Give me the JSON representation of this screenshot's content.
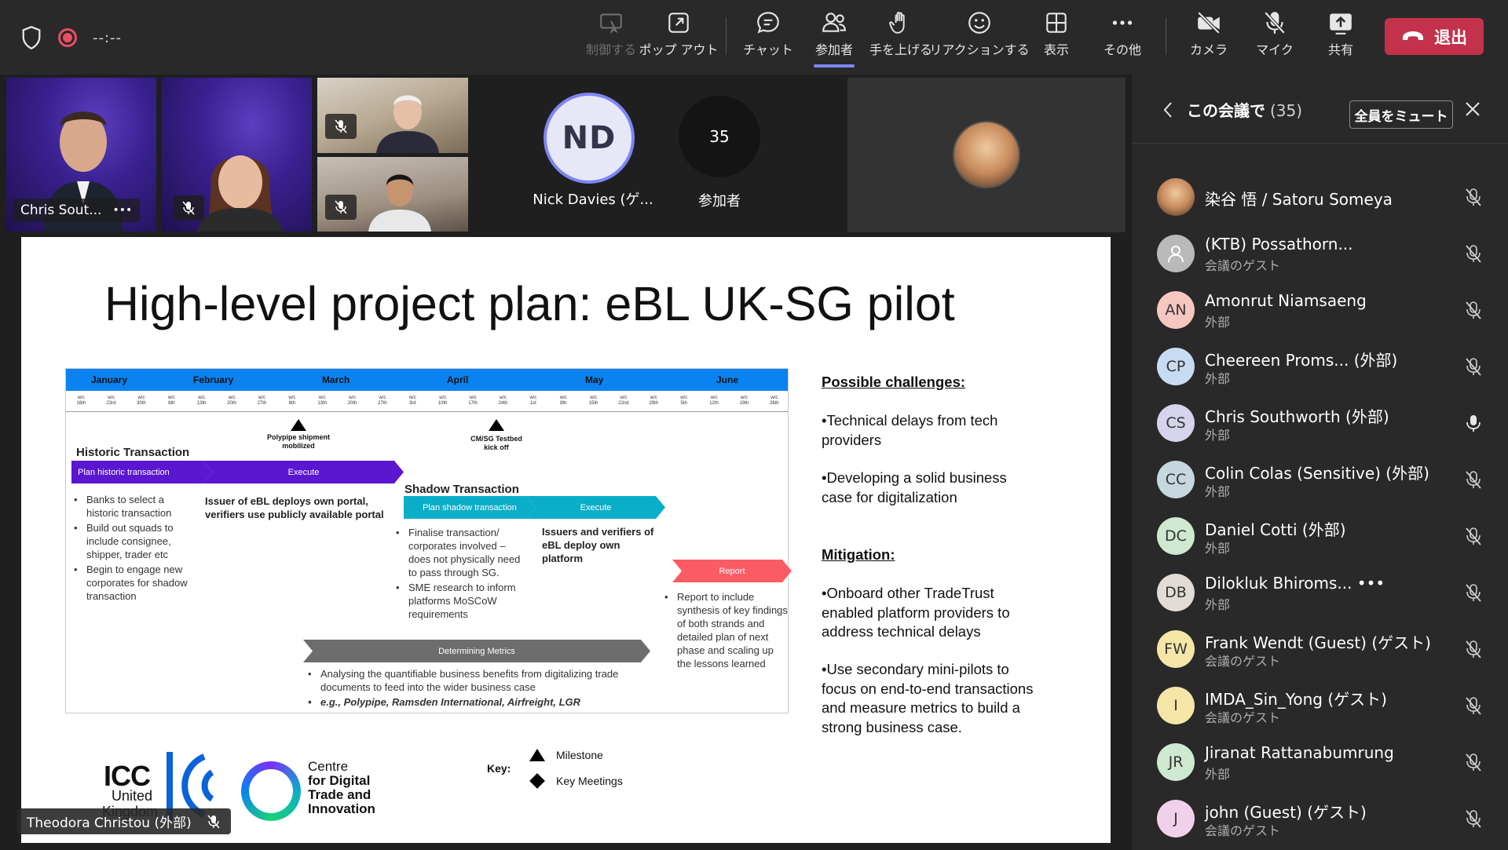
{
  "topbar": {
    "timer": "--:--",
    "buttons": {
      "control": "制御する",
      "popout": "ポップ アウト",
      "chat": "チャット",
      "participants": "参加者",
      "raise_hand": "手を上げる",
      "react": "リアクションする",
      "view": "表示",
      "more": "その他",
      "camera": "カメラ",
      "mic": "マイク",
      "share": "共有",
      "leave": "退出"
    }
  },
  "videos": {
    "tile1_name": "Chris Sout...",
    "tile1_more": "•••",
    "nick_initials": "ND",
    "nick_name": "Nick Davies (ゲ...",
    "count": "35",
    "count_label": "参加者"
  },
  "slide": {
    "title": "High-level project plan: eBL UK-SG pilot",
    "months": [
      "January",
      "February",
      "March",
      "April",
      "May",
      "June"
    ],
    "weeks": [
      "w/c 16th",
      "w/c 23rd",
      "w/c 30th",
      "w/c 6th",
      "w/c 13th",
      "w/c 20th",
      "w/c 27th",
      "w/c 6th",
      "w/c 13th",
      "w/c 20th",
      "w/c 27th",
      "w/c 3rd",
      "w/c 10th",
      "w/c 17th",
      "w/c 24th",
      "w/c 1st",
      "w/c 8th",
      "w/c 15th",
      "w/c 22nd",
      "w/c 29th",
      "w/c 5th",
      "w/c 12th",
      "w/c 19th",
      "w/c 26th"
    ],
    "milestone1": "Polypipe shipment mobilized",
    "milestone2": "CM/SG Testbed kick off",
    "historic_header": "Historic Transaction",
    "plan_historic": "Plan historic transaction",
    "execute1": "Execute",
    "historic_bullets": [
      "Banks to select a historic transaction",
      "Build out squads to include consignee, shipper, trader etc",
      "Begin to engage new corporates for shadow transaction"
    ],
    "execute1_text": "Issuer of eBL deploys own portal, verifiers use publicly available portal",
    "shadow_header": "Shadow Transaction",
    "plan_shadow": "Plan shadow transaction",
    "execute2": "Execute",
    "shadow_bullets": [
      "Finalise transaction/ corporates involved – does not physically need to pass through SG.",
      "SME research to inform platforms MoSCoW requirements"
    ],
    "execute2_text": "Issuers and verifiers of eBL deploy own platform",
    "report": "Report",
    "report_bullets": [
      "Report to include synthesis of key findings of both strands  and detailed plan of next phase and scaling up the lessons learned"
    ],
    "metrics": "Determining Metrics",
    "metrics_bullet1": "Analysing the quantifiable business benefits from digitalizing trade documents to feed into the wider business case",
    "metrics_bullet2": "e.g., Polypipe, Ramsden International, Airfreight, LGR",
    "challenges_h": "Possible challenges:",
    "challenge1": "•Technical delays from tech providers",
    "challenge2": "•Developing a solid business case for digitalization",
    "mitigation_h": "Mitigation:",
    "mitigation1": "•Onboard other TradeTrust enabled platform providers to address technical delays",
    "mitigation2": "•Use secondary mini-pilots to focus on end-to-end transactions and measure metrics to build a strong business case.",
    "key_label": "Key:",
    "key_milestone": "Milestone",
    "key_meetings": "Key Meetings",
    "icc_line1": "ICC",
    "icc_line2": "United",
    "icc_line3": "Kingdom",
    "cdti_line1": "Centre",
    "cdti_line2": "for Digital",
    "cdti_line3": "Trade and",
    "cdti_line4": "Innovation"
  },
  "presenter": "Theodora Christou (外部)",
  "panel": {
    "title": "この会議で",
    "count": "(35)",
    "mute_all": "全員をミュート",
    "participants": [
      {
        "name": "染谷 悟 / Satoru Someya",
        "sub": "",
        "initials": "",
        "avatar_color": "#c7a07a",
        "mic": "muted"
      },
      {
        "name": "(KTB) Possathorn...",
        "sub": "会議のゲスト",
        "initials": "",
        "avatar_color": "#b9b9b9",
        "mic": "muted"
      },
      {
        "name": "Amonrut Niamsaeng",
        "sub": "外部",
        "initials": "AN",
        "avatar_color": "#f6c7c0",
        "mic": "muted"
      },
      {
        "name": "Cheereen Proms... (外部)",
        "sub": "外部",
        "initials": "CP",
        "avatar_color": "#c7dcf2",
        "mic": "muted"
      },
      {
        "name": "Chris Southworth (外部)",
        "sub": "外部",
        "initials": "CS",
        "avatar_color": "#d5d4ec",
        "mic": "on"
      },
      {
        "name": "Colin Colas (Sensitive) (外部)",
        "sub": "外部",
        "initials": "CC",
        "avatar_color": "#c7d7df",
        "mic": "muted"
      },
      {
        "name": "Daniel Cotti (外部)",
        "sub": "外部",
        "initials": "DC",
        "avatar_color": "#cfe8d0",
        "mic": "muted"
      },
      {
        "name": "Dilokluk Bhiroms... •••",
        "sub": "外部",
        "initials": "DB",
        "avatar_color": "#e2dcd6",
        "mic": "muted"
      },
      {
        "name": "Frank Wendt (Guest) (ゲスト)",
        "sub": "会議のゲスト",
        "initials": "FW",
        "avatar_color": "#f5e6a8",
        "mic": "muted"
      },
      {
        "name": "IMDA_Sin_Yong (ゲスト)",
        "sub": "会議のゲスト",
        "initials": "I",
        "avatar_color": "#f5e6a8",
        "mic": "muted"
      },
      {
        "name": "Jiranat Rattanabumrung",
        "sub": "外部",
        "initials": "JR",
        "avatar_color": "#cfe8d0",
        "mic": "muted"
      },
      {
        "name": "john (Guest) (ゲスト)",
        "sub": "会議のゲスト",
        "initials": "J",
        "avatar_color": "#f1d1ea",
        "mic": "muted"
      }
    ]
  }
}
